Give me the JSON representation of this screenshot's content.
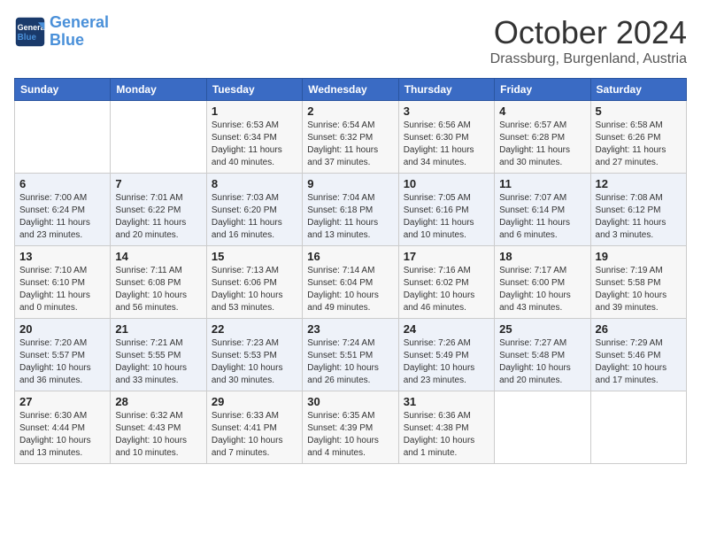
{
  "header": {
    "logo_line1": "General",
    "logo_line2": "Blue",
    "month": "October 2024",
    "location": "Drassburg, Burgenland, Austria"
  },
  "weekdays": [
    "Sunday",
    "Monday",
    "Tuesday",
    "Wednesday",
    "Thursday",
    "Friday",
    "Saturday"
  ],
  "weeks": [
    [
      {
        "day": "",
        "info": ""
      },
      {
        "day": "",
        "info": ""
      },
      {
        "day": "1",
        "info": "Sunrise: 6:53 AM\nSunset: 6:34 PM\nDaylight: 11 hours and 40 minutes."
      },
      {
        "day": "2",
        "info": "Sunrise: 6:54 AM\nSunset: 6:32 PM\nDaylight: 11 hours and 37 minutes."
      },
      {
        "day": "3",
        "info": "Sunrise: 6:56 AM\nSunset: 6:30 PM\nDaylight: 11 hours and 34 minutes."
      },
      {
        "day": "4",
        "info": "Sunrise: 6:57 AM\nSunset: 6:28 PM\nDaylight: 11 hours and 30 minutes."
      },
      {
        "day": "5",
        "info": "Sunrise: 6:58 AM\nSunset: 6:26 PM\nDaylight: 11 hours and 27 minutes."
      }
    ],
    [
      {
        "day": "6",
        "info": "Sunrise: 7:00 AM\nSunset: 6:24 PM\nDaylight: 11 hours and 23 minutes."
      },
      {
        "day": "7",
        "info": "Sunrise: 7:01 AM\nSunset: 6:22 PM\nDaylight: 11 hours and 20 minutes."
      },
      {
        "day": "8",
        "info": "Sunrise: 7:03 AM\nSunset: 6:20 PM\nDaylight: 11 hours and 16 minutes."
      },
      {
        "day": "9",
        "info": "Sunrise: 7:04 AM\nSunset: 6:18 PM\nDaylight: 11 hours and 13 minutes."
      },
      {
        "day": "10",
        "info": "Sunrise: 7:05 AM\nSunset: 6:16 PM\nDaylight: 11 hours and 10 minutes."
      },
      {
        "day": "11",
        "info": "Sunrise: 7:07 AM\nSunset: 6:14 PM\nDaylight: 11 hours and 6 minutes."
      },
      {
        "day": "12",
        "info": "Sunrise: 7:08 AM\nSunset: 6:12 PM\nDaylight: 11 hours and 3 minutes."
      }
    ],
    [
      {
        "day": "13",
        "info": "Sunrise: 7:10 AM\nSunset: 6:10 PM\nDaylight: 11 hours and 0 minutes."
      },
      {
        "day": "14",
        "info": "Sunrise: 7:11 AM\nSunset: 6:08 PM\nDaylight: 10 hours and 56 minutes."
      },
      {
        "day": "15",
        "info": "Sunrise: 7:13 AM\nSunset: 6:06 PM\nDaylight: 10 hours and 53 minutes."
      },
      {
        "day": "16",
        "info": "Sunrise: 7:14 AM\nSunset: 6:04 PM\nDaylight: 10 hours and 49 minutes."
      },
      {
        "day": "17",
        "info": "Sunrise: 7:16 AM\nSunset: 6:02 PM\nDaylight: 10 hours and 46 minutes."
      },
      {
        "day": "18",
        "info": "Sunrise: 7:17 AM\nSunset: 6:00 PM\nDaylight: 10 hours and 43 minutes."
      },
      {
        "day": "19",
        "info": "Sunrise: 7:19 AM\nSunset: 5:58 PM\nDaylight: 10 hours and 39 minutes."
      }
    ],
    [
      {
        "day": "20",
        "info": "Sunrise: 7:20 AM\nSunset: 5:57 PM\nDaylight: 10 hours and 36 minutes."
      },
      {
        "day": "21",
        "info": "Sunrise: 7:21 AM\nSunset: 5:55 PM\nDaylight: 10 hours and 33 minutes."
      },
      {
        "day": "22",
        "info": "Sunrise: 7:23 AM\nSunset: 5:53 PM\nDaylight: 10 hours and 30 minutes."
      },
      {
        "day": "23",
        "info": "Sunrise: 7:24 AM\nSunset: 5:51 PM\nDaylight: 10 hours and 26 minutes."
      },
      {
        "day": "24",
        "info": "Sunrise: 7:26 AM\nSunset: 5:49 PM\nDaylight: 10 hours and 23 minutes."
      },
      {
        "day": "25",
        "info": "Sunrise: 7:27 AM\nSunset: 5:48 PM\nDaylight: 10 hours and 20 minutes."
      },
      {
        "day": "26",
        "info": "Sunrise: 7:29 AM\nSunset: 5:46 PM\nDaylight: 10 hours and 17 minutes."
      }
    ],
    [
      {
        "day": "27",
        "info": "Sunrise: 6:30 AM\nSunset: 4:44 PM\nDaylight: 10 hours and 13 minutes."
      },
      {
        "day": "28",
        "info": "Sunrise: 6:32 AM\nSunset: 4:43 PM\nDaylight: 10 hours and 10 minutes."
      },
      {
        "day": "29",
        "info": "Sunrise: 6:33 AM\nSunset: 4:41 PM\nDaylight: 10 hours and 7 minutes."
      },
      {
        "day": "30",
        "info": "Sunrise: 6:35 AM\nSunset: 4:39 PM\nDaylight: 10 hours and 4 minutes."
      },
      {
        "day": "31",
        "info": "Sunrise: 6:36 AM\nSunset: 4:38 PM\nDaylight: 10 hours and 1 minute."
      },
      {
        "day": "",
        "info": ""
      },
      {
        "day": "",
        "info": ""
      }
    ]
  ]
}
